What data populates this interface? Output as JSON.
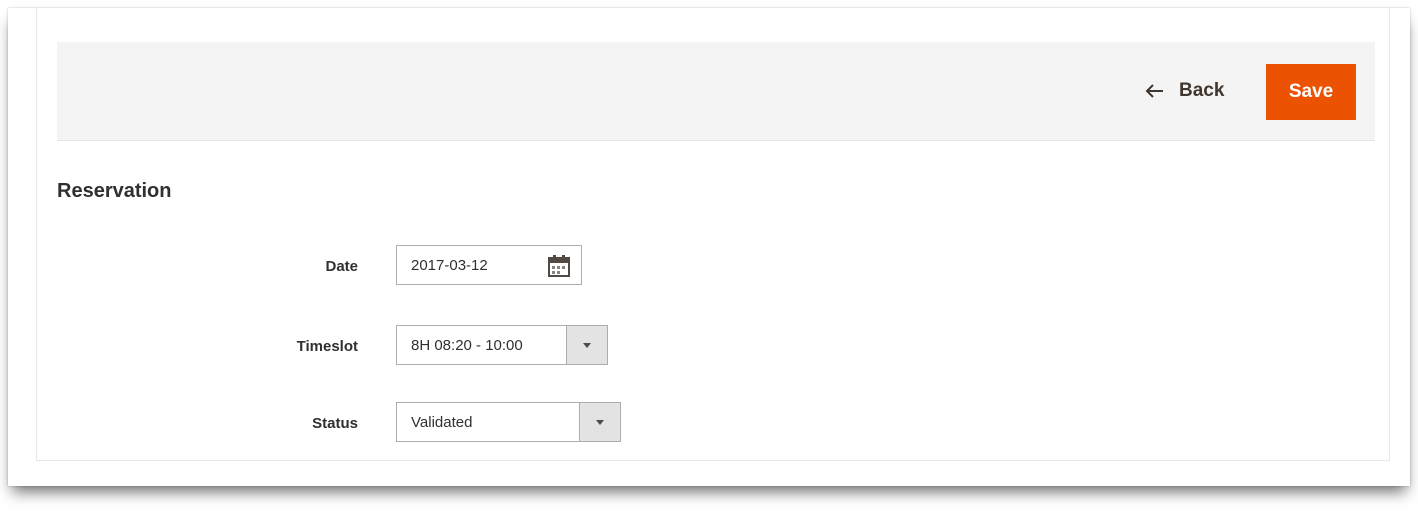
{
  "toolbar": {
    "back_label": "Back",
    "save_label": "Save"
  },
  "section": {
    "title": "Reservation"
  },
  "form": {
    "date": {
      "label": "Date",
      "value": "2017-03-12",
      "icon": "calendar-icon"
    },
    "timeslot": {
      "label": "Timeslot",
      "value": "8H 08:20 - 10:00"
    },
    "status": {
      "label": "Status",
      "value": "Validated"
    }
  },
  "colors": {
    "accent": "#eb5202",
    "action_bar_bg": "#f4f4f4",
    "text": "#303030"
  }
}
